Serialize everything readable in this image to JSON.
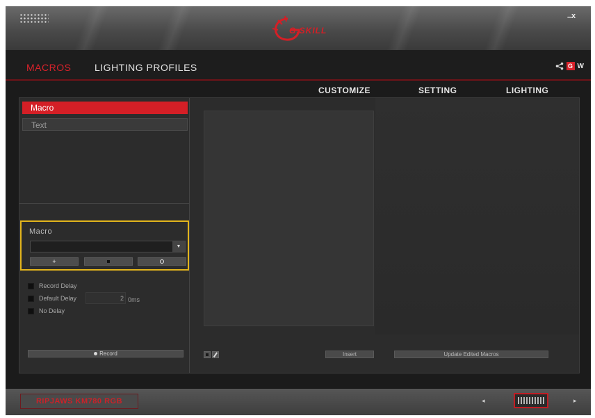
{
  "window": {
    "logo_text": "G.SKILL",
    "minimize_label": "–",
    "close_label": "x"
  },
  "nav": {
    "macros_label": "MACROS",
    "lighting_profiles_label": "LIGHTING PROFILES",
    "g_badge": "G",
    "w_badge": "W"
  },
  "subtabs": {
    "customize": "CUSTOMIZE",
    "setting": "SETTING",
    "lighting": "LIGHTING"
  },
  "left_panel": {
    "modes": [
      {
        "label": "Macro"
      },
      {
        "label": "Text"
      }
    ],
    "macro_box": {
      "label": "Macro",
      "selected_value": "",
      "add_label": "+"
    },
    "options": {
      "record_delay": "Record Delay",
      "default_delay": "Default Delay",
      "default_delay_value": "2",
      "default_delay_unit": "0ms",
      "no_delay": "No Delay"
    },
    "record_label": "Record"
  },
  "editor": {
    "insert_label": "Insert",
    "update_label": "Update Edited Macros"
  },
  "footer": {
    "device_name": "RIPJAWS KM780 RGB",
    "prev_label": "◂",
    "next_label": "▸"
  },
  "colors": {
    "accent": "#d41f26",
    "highlight_border": "#e3b51c",
    "background": "#1b1b1b",
    "panel": "#2c2c2c"
  }
}
